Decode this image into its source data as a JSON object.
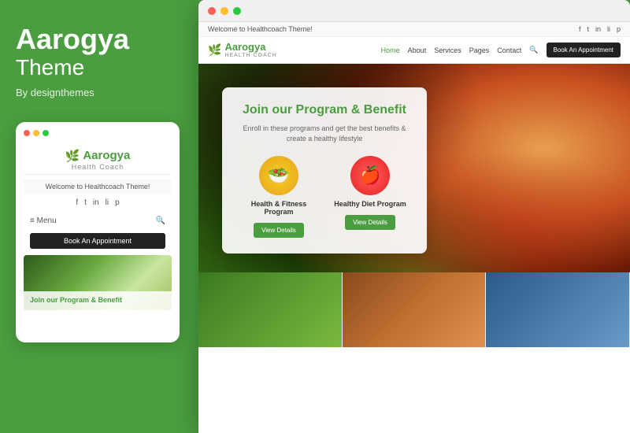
{
  "left": {
    "brand_title": "Aarogya",
    "brand_theme": "Theme",
    "by_line": "By designthemes"
  },
  "mobile_mockup": {
    "logo_name": "Aarogya",
    "logo_sub": "Health Coach",
    "welcome_text": "Welcome to Healthcoach Theme!",
    "social_icons": [
      "f",
      "t",
      "in",
      "li",
      "p"
    ],
    "menu_label": "≡  Menu",
    "book_btn": "Book An Appointment",
    "hero_text": "Join our Program &\nBenefit"
  },
  "desktop": {
    "topbar_welcome": "Welcome to Healthcoach Theme!",
    "social_icons": [
      "f",
      "t",
      "in",
      "li",
      "p"
    ],
    "logo_name": "Aarogya",
    "logo_sub": "Health Coach",
    "nav_links": [
      "Home",
      "About",
      "Services",
      "Pages",
      "Contact"
    ],
    "book_btn": "Book An Appointment",
    "program_card": {
      "title": "Join our Program & Benefit",
      "subtitle": "Enroll in these programs and get the best benefits & create\na healthy lifestyle",
      "items": [
        {
          "icon": "🥗",
          "label": "Health & Fitness Program",
          "btn": "View Details",
          "type": "fitness"
        },
        {
          "icon": "🍎",
          "label": "Healthy Diet Program",
          "btn": "View Details",
          "type": "diet"
        }
      ]
    }
  },
  "colors": {
    "green": "#4a9e3f",
    "dark": "#222222"
  }
}
